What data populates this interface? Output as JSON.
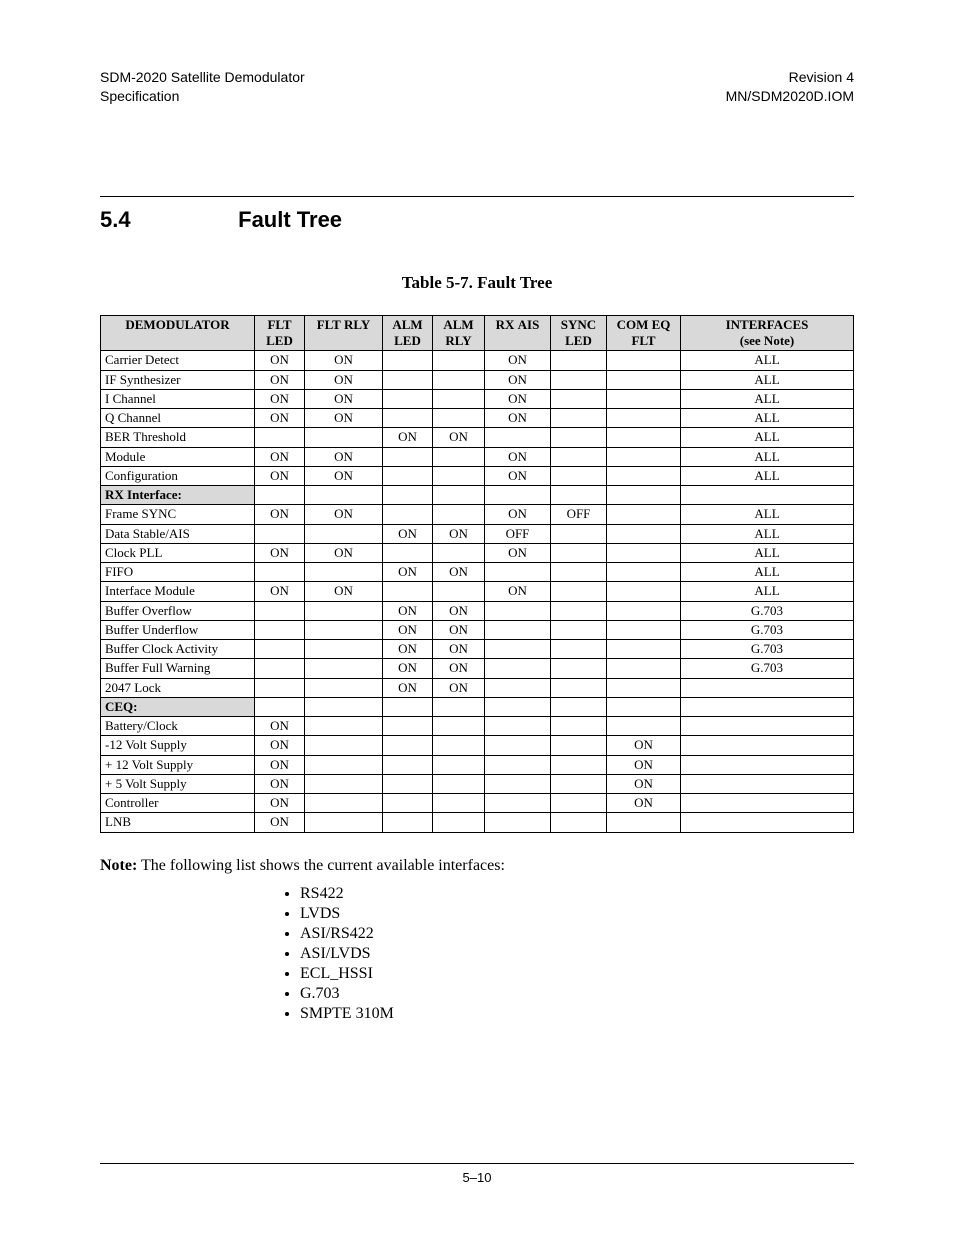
{
  "header": {
    "left1": "SDM-2020 Satellite Demodulator",
    "left2": "Specification",
    "right1": "Revision 4",
    "right2": "MN/SDM2020D.IOM"
  },
  "section": {
    "number": "5.4",
    "title": "Fault Tree"
  },
  "table": {
    "caption": "Table 5-7.  Fault Tree",
    "columns": [
      {
        "l1": "",
        "l2": "DEMODULATOR",
        "l3": ""
      },
      {
        "l1": "FLT",
        "l2": "LED",
        "l3": ""
      },
      {
        "l1": "",
        "l2": "FLT RLY",
        "l3": ""
      },
      {
        "l1": "ALM",
        "l2": "LED",
        "l3": ""
      },
      {
        "l1": "ALM",
        "l2": "RLY",
        "l3": ""
      },
      {
        "l1": "",
        "l2": "RX AIS",
        "l3": ""
      },
      {
        "l1": "SYNC",
        "l2": "LED",
        "l3": ""
      },
      {
        "l1": "COM EQ",
        "l2": "FLT",
        "l3": ""
      },
      {
        "l1": "",
        "l2": "INTERFACES",
        "l3": "(see Note)"
      }
    ],
    "rows": [
      {
        "name": "Carrier Detect",
        "c": [
          "ON",
          "ON",
          "",
          "",
          "ON",
          "",
          "",
          "ALL"
        ]
      },
      {
        "name": "IF Synthesizer",
        "c": [
          "ON",
          "ON",
          "",
          "",
          "ON",
          "",
          "",
          "ALL"
        ]
      },
      {
        "name": "I Channel",
        "c": [
          "ON",
          "ON",
          "",
          "",
          "ON",
          "",
          "",
          "ALL"
        ]
      },
      {
        "name": "Q Channel",
        "c": [
          "ON",
          "ON",
          "",
          "",
          "ON",
          "",
          "",
          "ALL"
        ]
      },
      {
        "name": "BER Threshold",
        "c": [
          "",
          "",
          "ON",
          "ON",
          "",
          "",
          "",
          "ALL"
        ]
      },
      {
        "name": "Module",
        "c": [
          "ON",
          "ON",
          "",
          "",
          "ON",
          "",
          "",
          "ALL"
        ]
      },
      {
        "name": "Configuration",
        "c": [
          "ON",
          "ON",
          "",
          "",
          "ON",
          "",
          "",
          "ALL"
        ]
      },
      {
        "section": true,
        "name": "RX Interface:"
      },
      {
        "name": "Frame SYNC",
        "c": [
          "ON",
          "ON",
          "",
          "",
          "ON",
          "OFF",
          "",
          "ALL"
        ]
      },
      {
        "name": "Data Stable/AIS",
        "c": [
          "",
          "",
          "ON",
          "ON",
          "OFF",
          "",
          "",
          "ALL"
        ]
      },
      {
        "name": "Clock PLL",
        "c": [
          "ON",
          "ON",
          "",
          "",
          "ON",
          "",
          "",
          "ALL"
        ]
      },
      {
        "name": "FIFO",
        "c": [
          "",
          "",
          "ON",
          "ON",
          "",
          "",
          "",
          "ALL"
        ]
      },
      {
        "name": "Interface Module",
        "c": [
          "ON",
          "ON",
          "",
          "",
          "ON",
          "",
          "",
          "ALL"
        ]
      },
      {
        "name": "Buffer Overflow",
        "c": [
          "",
          "",
          "ON",
          "ON",
          "",
          "",
          "",
          "G.703"
        ]
      },
      {
        "name": "Buffer Underflow",
        "c": [
          "",
          "",
          "ON",
          "ON",
          "",
          "",
          "",
          "G.703"
        ]
      },
      {
        "name": "Buffer Clock Activity",
        "c": [
          "",
          "",
          "ON",
          "ON",
          "",
          "",
          "",
          "G.703"
        ]
      },
      {
        "name": "Buffer Full Warning",
        "c": [
          "",
          "",
          "ON",
          "ON",
          "",
          "",
          "",
          "G.703"
        ]
      },
      {
        "name": "2047 Lock",
        "c": [
          "",
          "",
          "ON",
          "ON",
          "",
          "",
          "",
          ""
        ]
      },
      {
        "section": true,
        "name": "CEQ:"
      },
      {
        "name": "Battery/Clock",
        "c": [
          "ON",
          "",
          "",
          "",
          "",
          "",
          "",
          ""
        ]
      },
      {
        "name": "-12 Volt Supply",
        "c": [
          "ON",
          "",
          "",
          "",
          "",
          "",
          "ON",
          ""
        ]
      },
      {
        "name": "+ 12 Volt Supply",
        "c": [
          "ON",
          "",
          "",
          "",
          "",
          "",
          "ON",
          ""
        ]
      },
      {
        "name": "+ 5 Volt Supply",
        "c": [
          "ON",
          "",
          "",
          "",
          "",
          "",
          "ON",
          ""
        ]
      },
      {
        "name": "Controller",
        "c": [
          "ON",
          "",
          "",
          "",
          "",
          "",
          "ON",
          ""
        ]
      },
      {
        "name": "LNB",
        "c": [
          "ON",
          "",
          "",
          "",
          "",
          "",
          "",
          ""
        ]
      }
    ]
  },
  "note": {
    "label": "Note:",
    "text": "The following list shows the current available interfaces:"
  },
  "interfaces_list": [
    "RS422",
    "LVDS",
    "ASI/RS422",
    "ASI/LVDS",
    "ECL_HSSI",
    "G.703",
    "SMPTE 310M"
  ],
  "footer": {
    "page": "5–10"
  }
}
